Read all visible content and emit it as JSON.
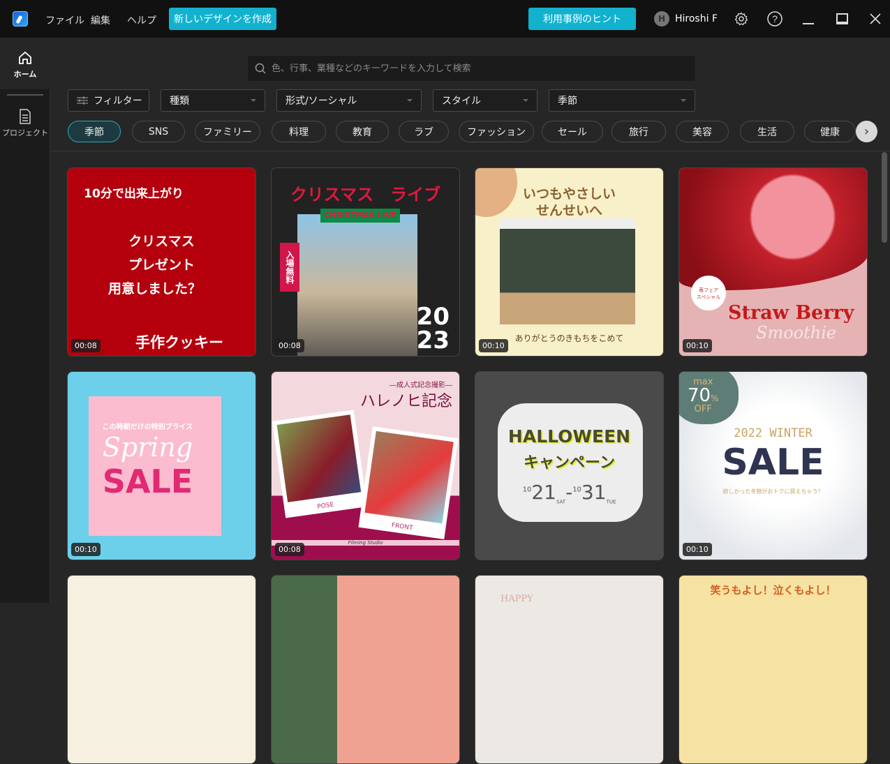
{
  "header": {
    "menu": [
      "ファイル",
      "編集",
      "ヘルプ"
    ],
    "create_button": "新しいデザインを作成",
    "hint_button": "利用事例のヒント",
    "user": {
      "initial": "H",
      "name": "Hiroshi F"
    }
  },
  "sidebar": {
    "items": [
      {
        "label": "ホーム",
        "icon": "home-icon"
      },
      {
        "label": "プロジェクト",
        "icon": "document-icon"
      }
    ]
  },
  "search": {
    "placeholder": "色、行事、業種などのキーワードを入力して検索",
    "value": ""
  },
  "filters": {
    "filter_button": "フィルター",
    "dropdowns": [
      "種類",
      "形式/ソーシャル",
      "スタイル",
      "季節"
    ]
  },
  "categories": {
    "active": "季節",
    "items": [
      "季節",
      "SNS",
      "ファミリー",
      "料理",
      "教育",
      "ラブ",
      "ファッション",
      "セール",
      "旅行",
      "美容",
      "生活",
      "健康"
    ]
  },
  "templates": [
    {
      "duration": "00:08",
      "texts": [
        "10分で出来上がり",
        "クリスマス",
        "プレゼント",
        "用意しました？",
        "手作クッキー"
      ]
    },
    {
      "duration": "00:08",
      "texts": [
        "クリスマス　ライブ",
        "CHRISTMAS LIVE",
        "入場無料",
        "20",
        "23"
      ]
    },
    {
      "duration": "00:10",
      "texts": [
        "いつもやさしい",
        "せんせいへ",
        "ありがとうのきもちをこめて"
      ]
    },
    {
      "duration": "00:10",
      "texts": [
        "苺フェア",
        "スペシャル",
        "Straw Berry",
        "Smoothie"
      ]
    },
    {
      "duration": "00:10",
      "texts": [
        "この時期だけの特別プライス",
        "Spring",
        "SALE"
      ]
    },
    {
      "duration": "00:08",
      "texts": [
        "―成人式記念撮影―",
        "ハレノヒ記念",
        "POSE",
        "FRONT",
        "Filming Studio"
      ]
    },
    {
      "duration": "",
      "texts": [
        "HALLOWEEN",
        "キャンペーン",
        "10",
        "21",
        "SAT",
        "-",
        "10",
        "31",
        "TUE"
      ]
    },
    {
      "duration": "00:10",
      "texts": [
        "max",
        "70",
        "%",
        "OFF",
        "2022 WINTER",
        "SALE",
        "欲しかった冬物がおトクに買えちゃう？"
      ]
    },
    {
      "duration": "",
      "texts": []
    },
    {
      "duration": "",
      "texts": []
    },
    {
      "duration": "",
      "texts": [
        "HAPPY"
      ]
    },
    {
      "duration": "",
      "texts": [
        "笑うもよし！泣くもよし！"
      ]
    }
  ]
}
